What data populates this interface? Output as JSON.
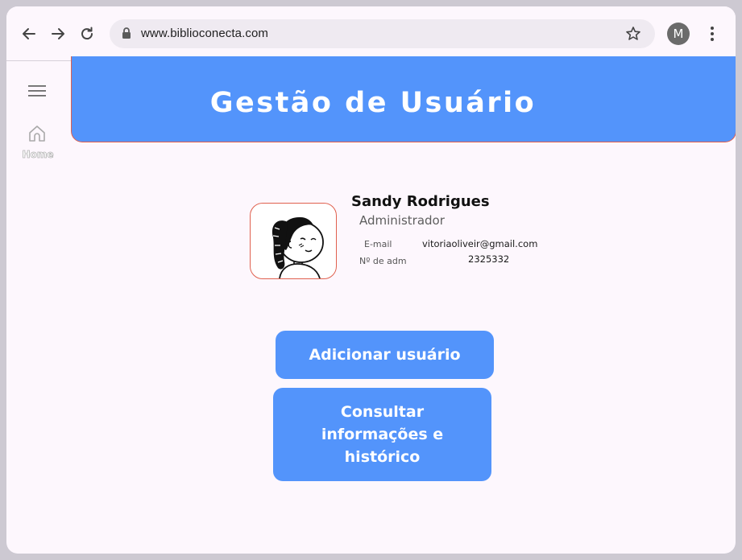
{
  "browser": {
    "url": "www.biblioconecta.com",
    "profile_initial": "M"
  },
  "sidebar": {
    "home_label": "Home"
  },
  "header": {
    "title": "Gestão de Usuário"
  },
  "profile": {
    "name": "Sandy Rodrigues",
    "role": "Administrador",
    "email_label": "E-mail",
    "email_value": "vitoriaoliveir@gmail.com",
    "adm_label": "Nº de adm",
    "adm_value": "2325332"
  },
  "actions": {
    "add_user": "Adicionar usuário",
    "consult": "Consultar informações e histórico"
  },
  "colors": {
    "primary": "#5394fb",
    "border_accent": "#e0604e",
    "page_bg": "#fdf7fd"
  },
  "icons": [
    "back-arrow-icon",
    "forward-arrow-icon",
    "reload-icon",
    "lock-icon",
    "star-icon",
    "kebab-menu-icon",
    "hamburger-menu-icon",
    "home-icon"
  ]
}
